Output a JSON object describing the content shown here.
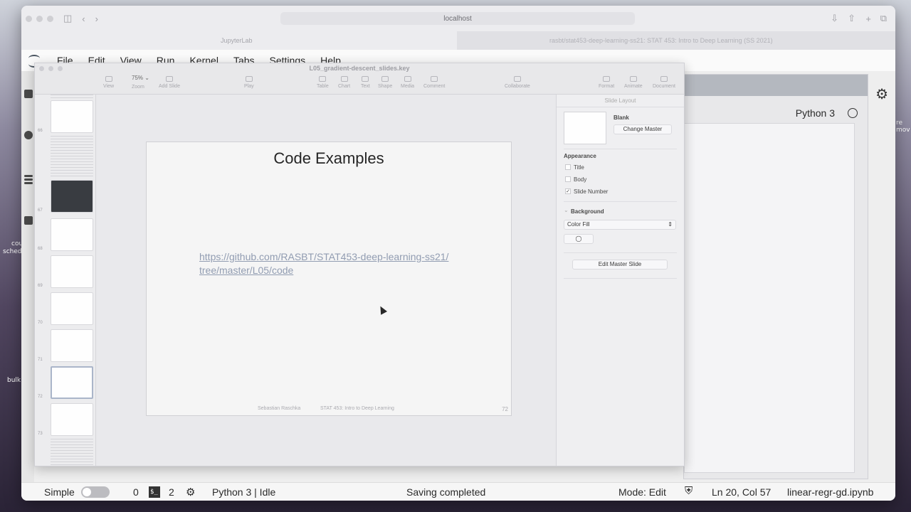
{
  "browser": {
    "url": "localhost",
    "tab_active": "JupyterLab",
    "tab_other": "rasbt/stat453-deep-learning-ss21: STAT 453: Intro to Deep Learning (SS 2021)"
  },
  "menu": [
    "File",
    "Edit",
    "View",
    "Run",
    "Kernel",
    "Tabs",
    "Settings",
    "Help"
  ],
  "notebook": {
    "kernel_name": "Python 3"
  },
  "keynote": {
    "window_title": "L05_gradient-descent_slides.key",
    "zoom": "75% ⌄",
    "tools": [
      "View",
      "Zoom",
      "Add Slide",
      "Play",
      "Table",
      "Chart",
      "Text",
      "Shape",
      "Media",
      "Comment",
      "Collaborate",
      "Format",
      "Animate",
      "Document"
    ],
    "slide_numbers": [
      "66",
      "67",
      "68",
      "69",
      "70",
      "71",
      "72",
      "73"
    ],
    "slide": {
      "title": "Code Examples",
      "link_line1": "https://github.com/RASBT/STAT453-deep-learning-ss21/",
      "link_line2": "tree/master/L05/code",
      "footer_author": "Sebastian Raschka",
      "footer_course": "STAT 453: Intro to Deep Learning",
      "number": "72"
    },
    "inspector": {
      "header": "Slide Layout",
      "master_name": "Blank",
      "change_master": "Change Master",
      "appearance": "Appearance",
      "opt_title": "Title",
      "opt_body": "Body",
      "opt_slide_number": "Slide Number",
      "background": "Background",
      "fill": "Color Fill",
      "edit_master": "Edit Master Slide"
    }
  },
  "status": {
    "mode_label": "Simple",
    "count0": "0",
    "count2": "2",
    "kernel": "Python 3 | Idle",
    "saving": "Saving completed",
    "mode": "Mode: Edit",
    "position": "Ln 20, Col 57",
    "filename": "linear-regr-gd.ipynb"
  },
  "desktop_labels": [
    "cou",
    "sched",
    "bulk",
    "re",
    "mov"
  ]
}
